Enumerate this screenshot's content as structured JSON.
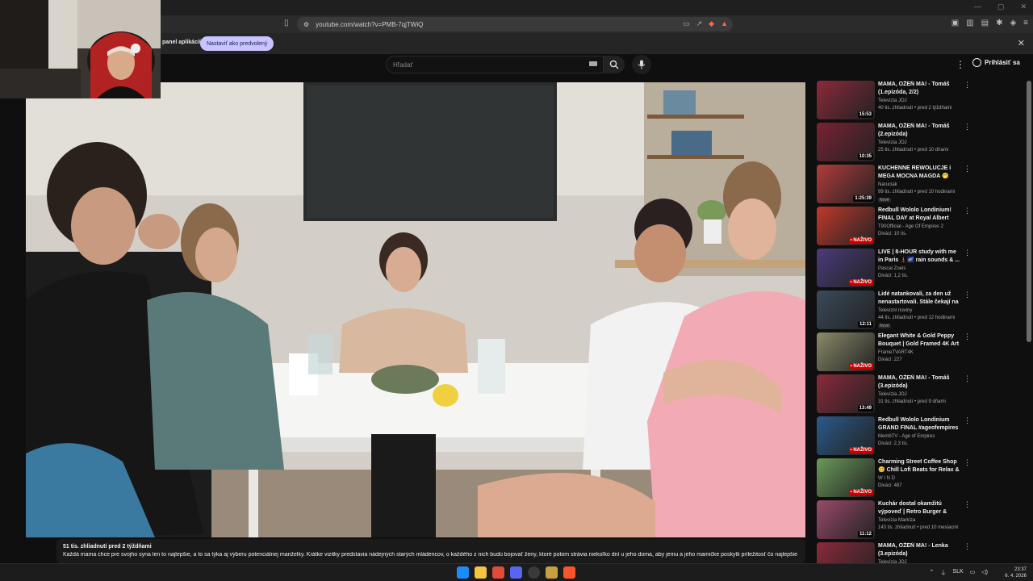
{
  "browser": {
    "url": "youtube.com/watch?v=PMB-7qjTWiQ",
    "infobar_text": "panel aplikácií",
    "infobar_button": "Nastaviť ako predvolený",
    "shield_color": "#ff6a3d"
  },
  "youtube": {
    "search_placeholder": "Hľadať",
    "sign_in": "Prihlásiť sa"
  },
  "video": {
    "views": "51 tis. zhliadnutí  pred 2 týždňami",
    "description": "Každá mama chce pre svojho syna len to najlepšie, a to sa týka aj výberu potenciálnej manželky. Krátke vizitky predstavia nádejných starých mládencov, o každého z nich budú bojovať ženy, ktoré potom strávia niekoľko dní u jeho doma, aby jemu a jeho mamičke poskytli príležitosť čo najlepšie"
  },
  "recommendations": [
    {
      "title": "MAMA, OŽEŇ MA! - Tomáš (1.epizóda, 2/2)",
      "channel": "Televízia JOJ",
      "meta": "40 tis. zhliadnutí • pred 2 týždňami",
      "duration": "15:53",
      "live": false,
      "badge": "",
      "thumb_color": "#8a2a3a"
    },
    {
      "title": "MAMA, OŽEŇ MA! - Tomáš (2.epizóda)",
      "channel": "Televízia JOJ",
      "meta": "25 tis. zhliadnutí • pred 10 dňami",
      "duration": "10:35",
      "live": false,
      "badge": "",
      "thumb_color": "#7a2233"
    },
    {
      "title": "KUCHENNE REWOLUCJE i MEGA MOCNA MAGDA 🤭",
      "channel": "Naruciak",
      "meta": "99 tis. zhliadnutí • pred 10 hodinami",
      "duration": "1:25:39",
      "live": false,
      "badge": "Nové",
      "thumb_color": "#b23b3b"
    },
    {
      "title": "Redbull Wololo Londinium! FINAL DAY at Royal Albert Hall!",
      "channel": "T90Official - Age Of Empires 2",
      "meta": "Diváci: 10 tis.",
      "duration": "",
      "live": true,
      "badge": "",
      "thumb_color": "#c0392b"
    },
    {
      "title": "LIVE | 8-HOUR study with me in Paris 🗼🌌 rain sounds & ...",
      "channel": "Pascal Zoeis",
      "meta": "Diváci: 1,2 tis.",
      "duration": "",
      "live": true,
      "badge": "",
      "thumb_color": "#4a3b7a"
    },
    {
      "title": "Lidé natankovali, za den už nenastartovali. Stále čekají na ...",
      "channel": "Televizní noviny",
      "meta": "44 tis. zhliadnutí • pred 12 hodinami",
      "duration": "12:11",
      "live": false,
      "badge": "Nové",
      "thumb_color": "#3a4a5a"
    },
    {
      "title": "Elegant White & Gold Peppy Bouquet | Gold Framed 4K Art ...",
      "channel": "FrameTVART4K",
      "meta": "Diváci: 227",
      "duration": "",
      "live": true,
      "badge": "",
      "thumb_color": "#8a8a6a"
    },
    {
      "title": "MAMA, OŽEŇ MA! - Tomáš (3.epizóda)",
      "channel": "Televízia JOJ",
      "meta": "31 tis. zhliadnutí • pred 9 dňami",
      "duration": "13:49",
      "live": false,
      "badge": "",
      "thumb_color": "#8a2a3a"
    },
    {
      "title": "Redbull Wololo Londinium GRAND FINAL #ageofempires",
      "channel": "MembTV - Age of Empires",
      "meta": "Diváci: 2,3 tis.",
      "duration": "",
      "live": true,
      "badge": "",
      "thumb_color": "#2a5a8a"
    },
    {
      "title": "Charming Street Coffee Shop 😊 Chill Lofi Beats for Relax & ...",
      "channel": "W I N D",
      "meta": "Diváci: 487",
      "duration": "",
      "live": true,
      "badge": "",
      "thumb_color": "#6a9a5a"
    },
    {
      "title": "Kuchár dostal okamžitú výpoveď | Retro Burger & Dinn...",
      "channel": "Televízia Markíza",
      "meta": "143 tis. zhliadnutí • pred 10 mesiacmi",
      "duration": "11:12",
      "live": false,
      "badge": "",
      "thumb_color": "#9a4a6a"
    },
    {
      "title": "MAMA, OŽEŇ MA! - Lenka (3.epizóda)",
      "channel": "Televízia JOJ",
      "meta": "",
      "duration": "",
      "live": false,
      "badge": "",
      "thumb_color": "#8a2a3a"
    }
  ],
  "live_label": "• NAŽIVO",
  "taskbar": {
    "lang": "SLK",
    "time": "23:37",
    "date": "6. 4. 2026"
  }
}
